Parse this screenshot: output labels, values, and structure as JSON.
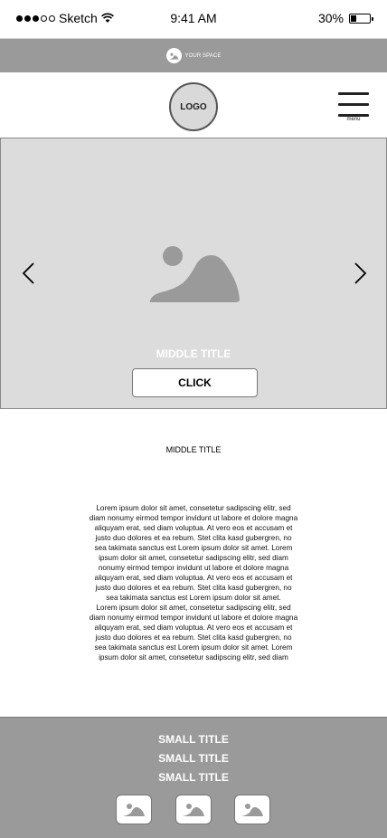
{
  "status_bar": {
    "carrier": "Sketch",
    "time": "9:41 AM",
    "battery_percent": "30%",
    "battery_level": 0.3,
    "signal_bars_filled": 3,
    "signal_bars_total": 5
  },
  "banner": {
    "icon": "image-icon",
    "text": "YOUR SPACE"
  },
  "header": {
    "logo_text": "LOGO",
    "menu_label": "menu"
  },
  "hero": {
    "prev_icon": "chevron-left-icon",
    "next_icon": "chevron-right-icon",
    "image_icon": "image-placeholder-icon",
    "title": "MIDDLE TITLE",
    "button_label": "CLICK"
  },
  "content": {
    "title": "MIDDLE TITLE",
    "lines": [
      "Lorem ipsum dolor sit amet, consetetur sadipscing elitr, sed",
      "diam nonumy eirmod tempor invidunt ut labore et dolore magna",
      "aliquyam erat, sed diam voluptua. At vero eos et accusam et",
      "justo duo dolores et ea rebum. Stet clita kasd gubergren, no",
      "sea takimata sanctus est Lorem ipsum dolor sit amet. Lorem",
      "ipsum dolor sit amet, consetetur sadipscing elitr, sed diam",
      "nonumy eirmod tempor invidunt ut labore et dolore magna",
      "aliquyam erat, sed diam voluptua. At vero eos et accusam et",
      "justo duo dolores et ea rebum. Stet clita kasd gubergren, no",
      "sea takimata sanctus est Lorem ipsum dolor sit amet.",
      "Lorem ipsum dolor sit amet, consetetur sadipscing elitr, sed",
      "diam nonumy eirmod tempor invidunt ut labore et dolore magna",
      "aliquyam erat, sed diam voluptua. At vero eos et accusam et",
      "justo duo dolores et ea rebum. Stet clita kasd gubergren, no",
      "sea takimata sanctus est Lorem ipsum dolor sit amet. Lorem",
      "ipsum dolor sit amet, consetetur sadipscing elitr, sed diam"
    ]
  },
  "footer": {
    "titles": [
      "SMALL TITLE",
      "SMALL TITLE",
      "SMALL TITLE"
    ],
    "icons": [
      "image-icon",
      "image-icon",
      "image-icon"
    ]
  },
  "colors": {
    "banner_bg": "#9a9a9a",
    "hero_bg": "#dcdcdc",
    "footer_bg": "#9a9a9a",
    "placeholder_gray": "#9a9a9a"
  }
}
